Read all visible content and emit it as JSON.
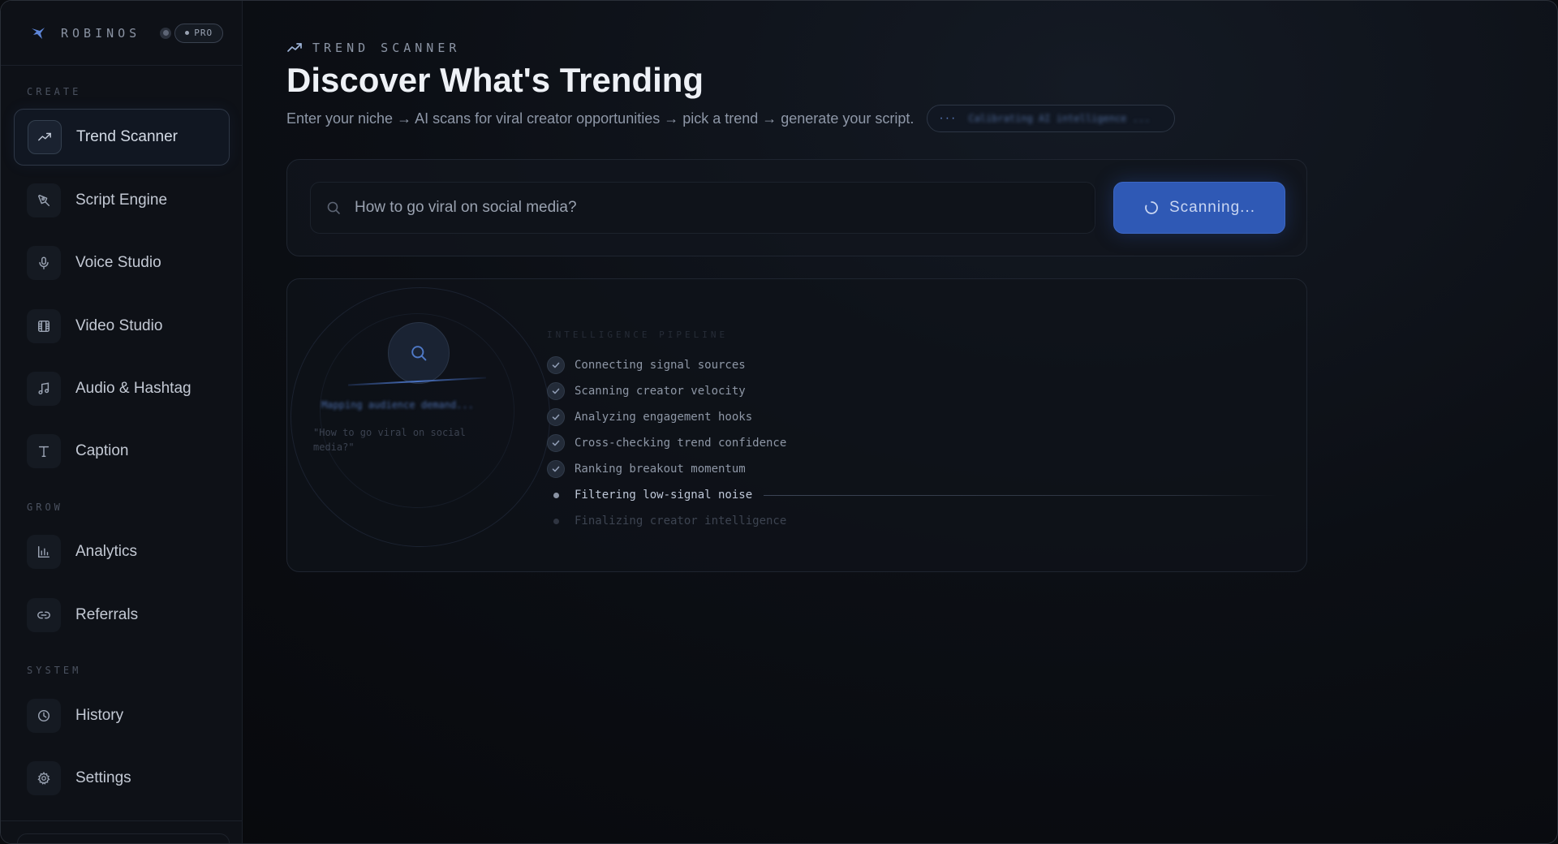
{
  "brand": {
    "name": "ROBINOS",
    "badge": "PRO"
  },
  "sidebar": {
    "sections": {
      "create": "CREATE",
      "grow": "GROW",
      "system": "SYSTEM"
    },
    "items": [
      {
        "label": "Trend Scanner",
        "icon": "trending-up-icon",
        "active": true
      },
      {
        "label": "Script Engine",
        "icon": "pen-tool-icon"
      },
      {
        "label": "Voice Studio",
        "icon": "microphone-icon"
      },
      {
        "label": "Video Studio",
        "icon": "film-icon"
      },
      {
        "label": "Audio & Hashtag",
        "icon": "music-note-icon"
      },
      {
        "label": "Caption",
        "icon": "type-icon"
      },
      {
        "label": "Analytics",
        "icon": "bar-chart-icon"
      },
      {
        "label": "Referrals",
        "icon": "link-icon"
      },
      {
        "label": "History",
        "icon": "clock-icon"
      },
      {
        "label": "Settings",
        "icon": "gear-icon"
      }
    ]
  },
  "header": {
    "eyebrow": "TREND SCANNER",
    "title": "Discover What's Trending",
    "subtitle": "Enter your niche → AI scans for viral creator opportunities → pick a trend → generate your script.",
    "status_dots": "···",
    "status_text": "Calibrating AI intelligence ..."
  },
  "search": {
    "value": "How to go viral on social media?",
    "button_label": "Scanning..."
  },
  "pipeline": {
    "radar_status": "Mapping audience demand...",
    "radar_query": "\"How to go viral on social media?\"",
    "label": "INTELLIGENCE PIPELINE",
    "steps": [
      {
        "text": "Connecting signal sources",
        "state": "done"
      },
      {
        "text": "Scanning creator velocity",
        "state": "done"
      },
      {
        "text": "Analyzing engagement hooks",
        "state": "done"
      },
      {
        "text": "Cross-checking trend confidence",
        "state": "done"
      },
      {
        "text": "Ranking breakout momentum",
        "state": "done"
      },
      {
        "text": "Filtering low-signal noise",
        "state": "active"
      },
      {
        "text": "Finalizing creator intelligence",
        "state": "pending"
      }
    ]
  },
  "colors": {
    "accent": "#2f59b5",
    "background": "#0a0c10",
    "sidebar": "#0e1117"
  }
}
